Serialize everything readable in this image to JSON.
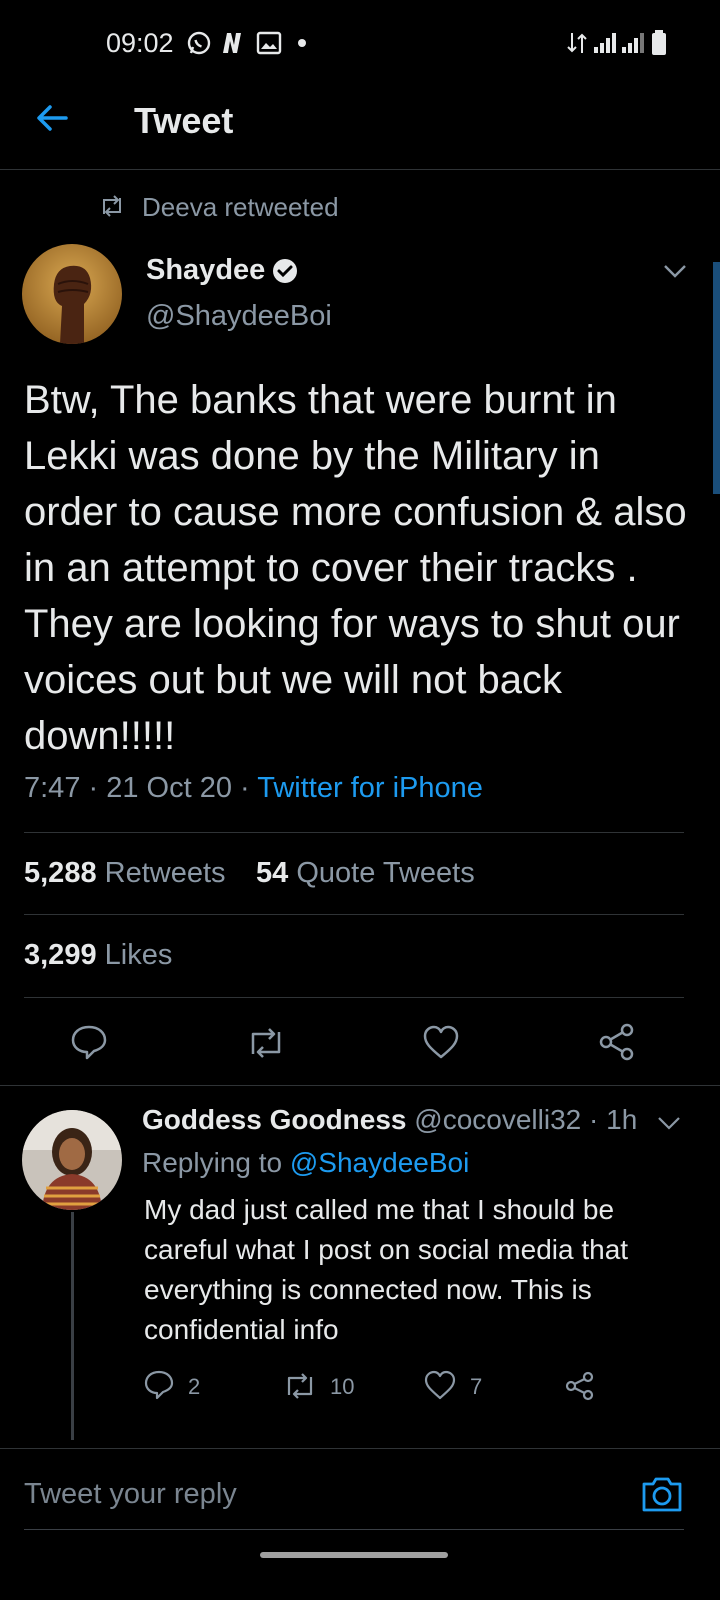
{
  "status_bar": {
    "time": "09:02"
  },
  "header": {
    "title": "Tweet"
  },
  "retweet_context": {
    "text": "Deeva retweeted"
  },
  "tweet": {
    "author_name": "Shaydee",
    "author_handle": "@ShaydeeBoi",
    "text": "Btw, The banks that were burnt in Lekki was done by the Military in order to cause more confusion & also in an attempt to cover their tracks . They are looking for ways to shut our voices out but we will not back down!!!!!",
    "time": "7:47",
    "date": "21 Oct 20",
    "source": "Twitter for iPhone",
    "retweets_count": "5,288",
    "retweets_label": "Retweets",
    "quotes_count": "54",
    "quotes_label": "Quote Tweets",
    "likes_count": "3,299",
    "likes_label": "Likes"
  },
  "reply": {
    "author_name": "Goddess Goodness",
    "author_handle": "@cocovelli32",
    "age": "1h",
    "replying_prefix": "Replying to",
    "replying_handle": "@ShaydeeBoi",
    "text": "My dad just called me that I should be careful what I post on social media that everything is connected now. This is confidential info",
    "replies": "2",
    "retweets": "10",
    "likes": "7"
  },
  "compose": {
    "placeholder": "Tweet your reply"
  },
  "colors": {
    "accent": "#1d9bf0",
    "background": "#000000",
    "divider": "#2f3336"
  }
}
